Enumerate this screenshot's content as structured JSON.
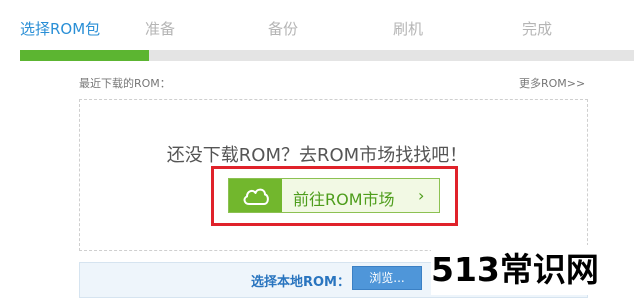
{
  "steps": [
    {
      "label": "选择ROM包",
      "active": true
    },
    {
      "label": "准备",
      "active": false
    },
    {
      "label": "备份",
      "active": false
    },
    {
      "label": "刷机",
      "active": false
    },
    {
      "label": "完成",
      "active": false
    }
  ],
  "progress": {
    "fraction": 0.21,
    "fill_color": "#5cb531"
  },
  "recent": {
    "label": "最近下载的ROM：",
    "more_link": "更多ROM>>"
  },
  "empty_state": {
    "message": "还没下载ROM？去ROM市场找找吧！"
  },
  "market_button": {
    "label": "前往ROM市场",
    "chevron": "›",
    "icon": "cloud-icon"
  },
  "local": {
    "label": "选择本地ROM：",
    "browse_button": "浏览..."
  },
  "watermark": {
    "text": "513常识网"
  },
  "colors": {
    "accent": "#2a8fd6",
    "green": "#72b72d",
    "highlight": "#e0222a"
  }
}
